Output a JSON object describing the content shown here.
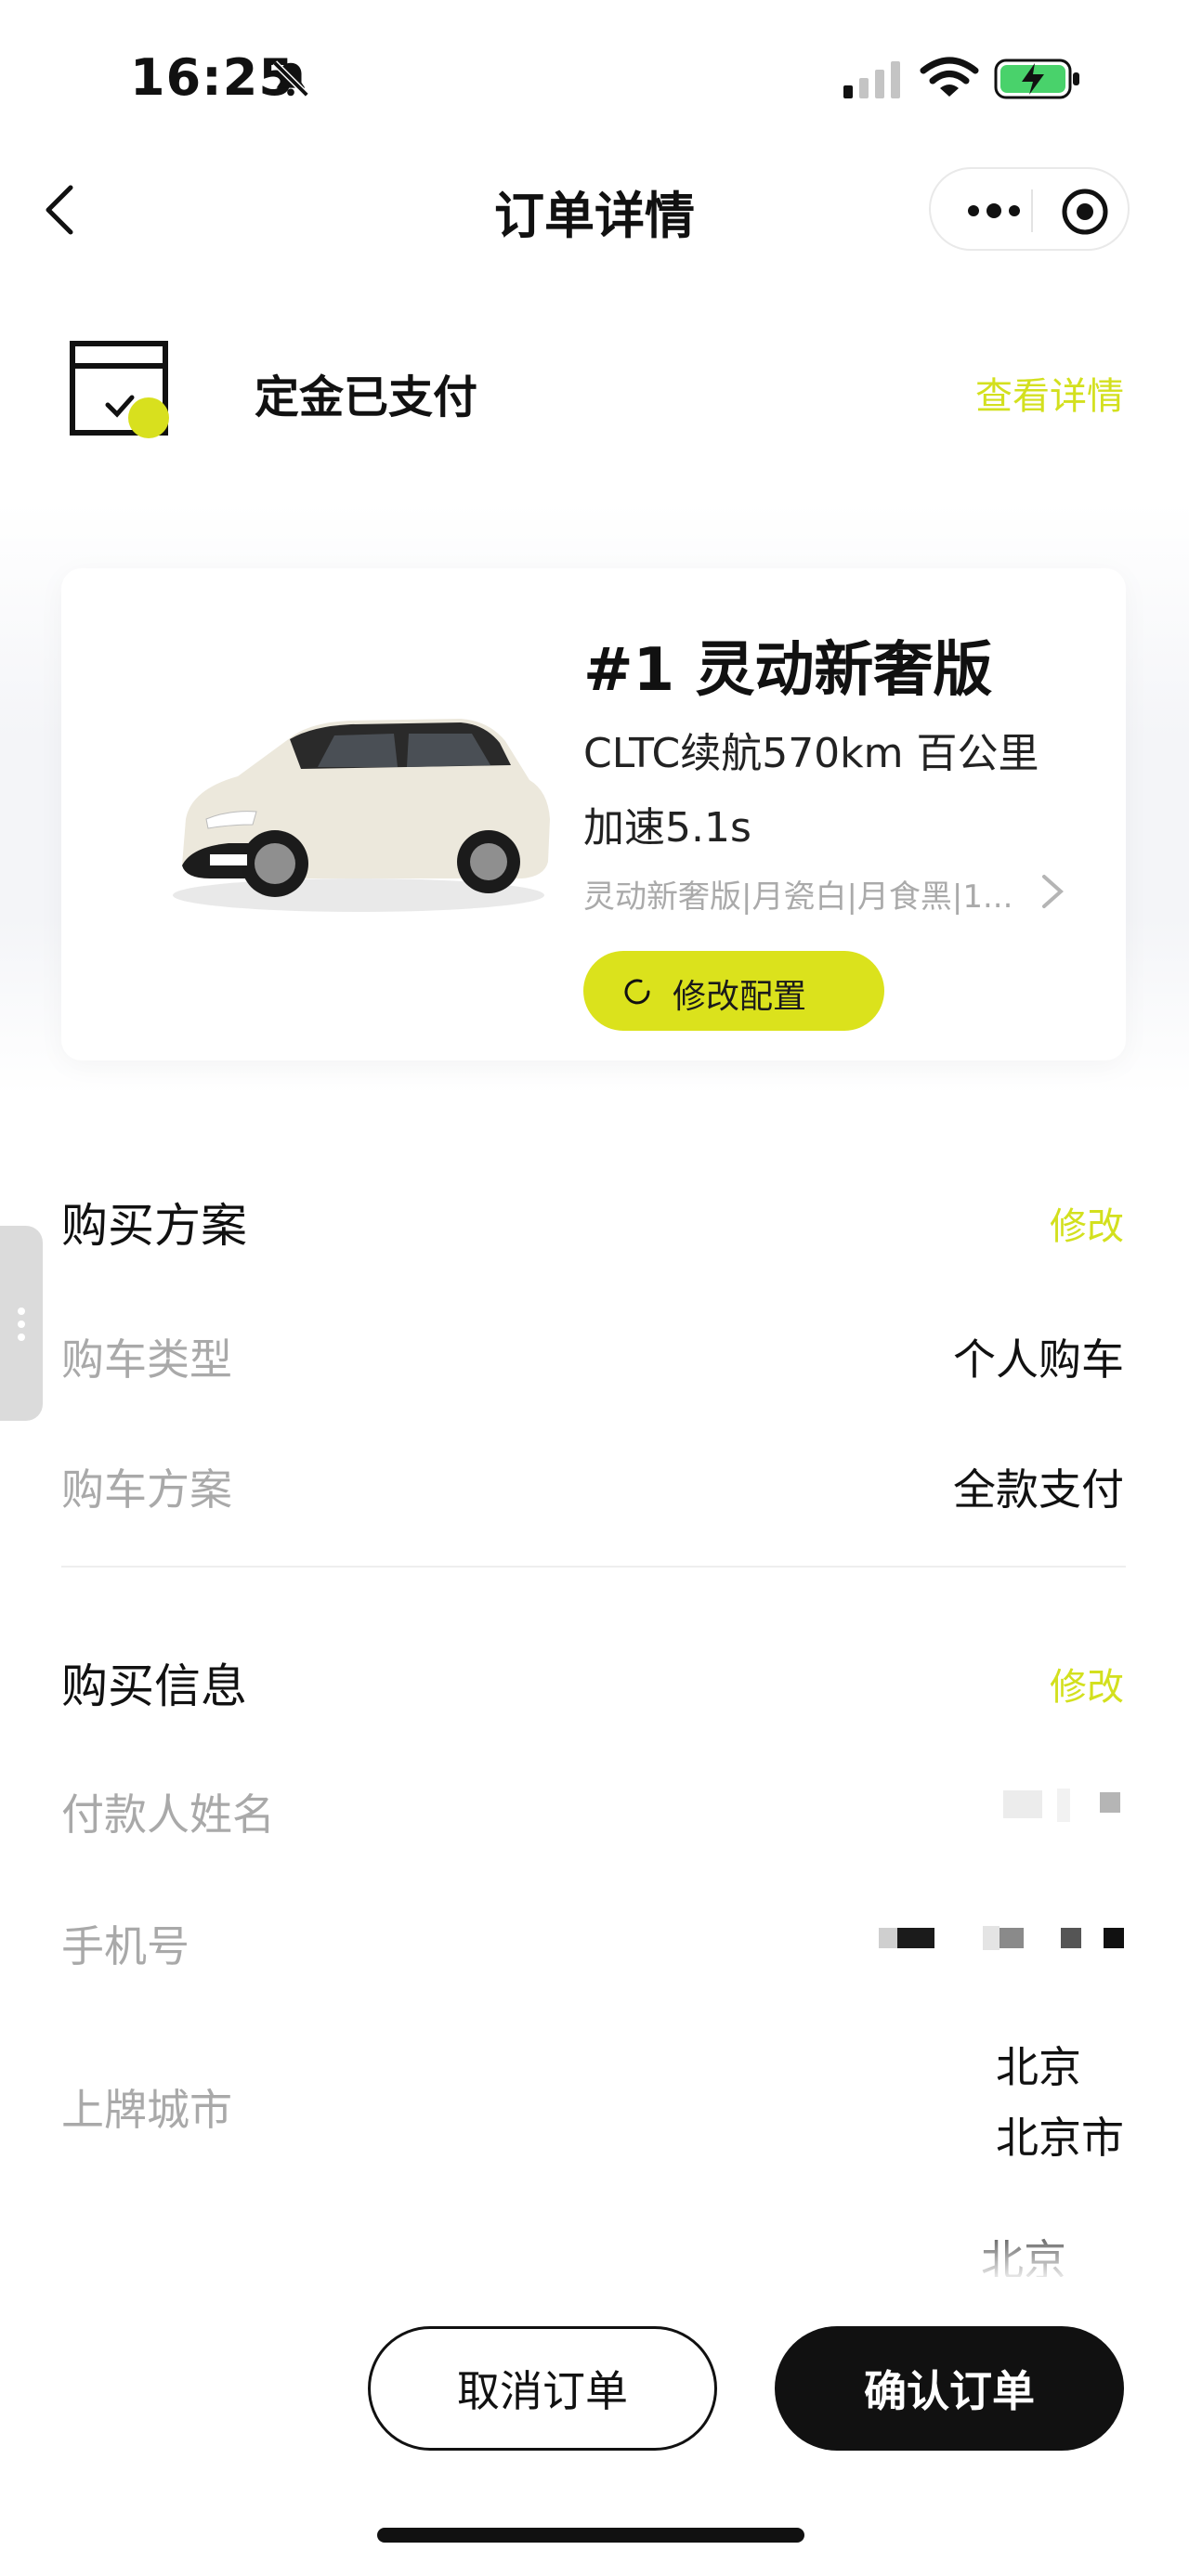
{
  "status_bar": {
    "time": "16:25"
  },
  "nav": {
    "title": "订单详情"
  },
  "deposit": {
    "status": "定金已支付",
    "view_details": "查看详情"
  },
  "car": {
    "name": "#1 灵动新奢版",
    "desc_line1": "CLTC续航570km 百公里",
    "desc_line2": "加速5.1s",
    "config": "灵动新奢版|月瓷白|月食黑|1...",
    "modify_config": "修改配置"
  },
  "purchase_plan": {
    "title": "购买方案",
    "edit": "修改",
    "rows": [
      {
        "label": "购车类型",
        "value": "个人购车"
      },
      {
        "label": "购车方案",
        "value": "全款支付"
      }
    ]
  },
  "purchase_info": {
    "title": "购买信息",
    "edit": "修改",
    "payer_label": "付款人姓名",
    "phone_label": "手机号",
    "city_label": "上牌城市",
    "city_value_1": "北京",
    "city_value_2": "北京市",
    "next_value": "北京"
  },
  "actions": {
    "cancel": "取消订单",
    "confirm": "确认订单"
  },
  "colors": {
    "accent": "#d8e01e",
    "primary_button": "#111111"
  }
}
